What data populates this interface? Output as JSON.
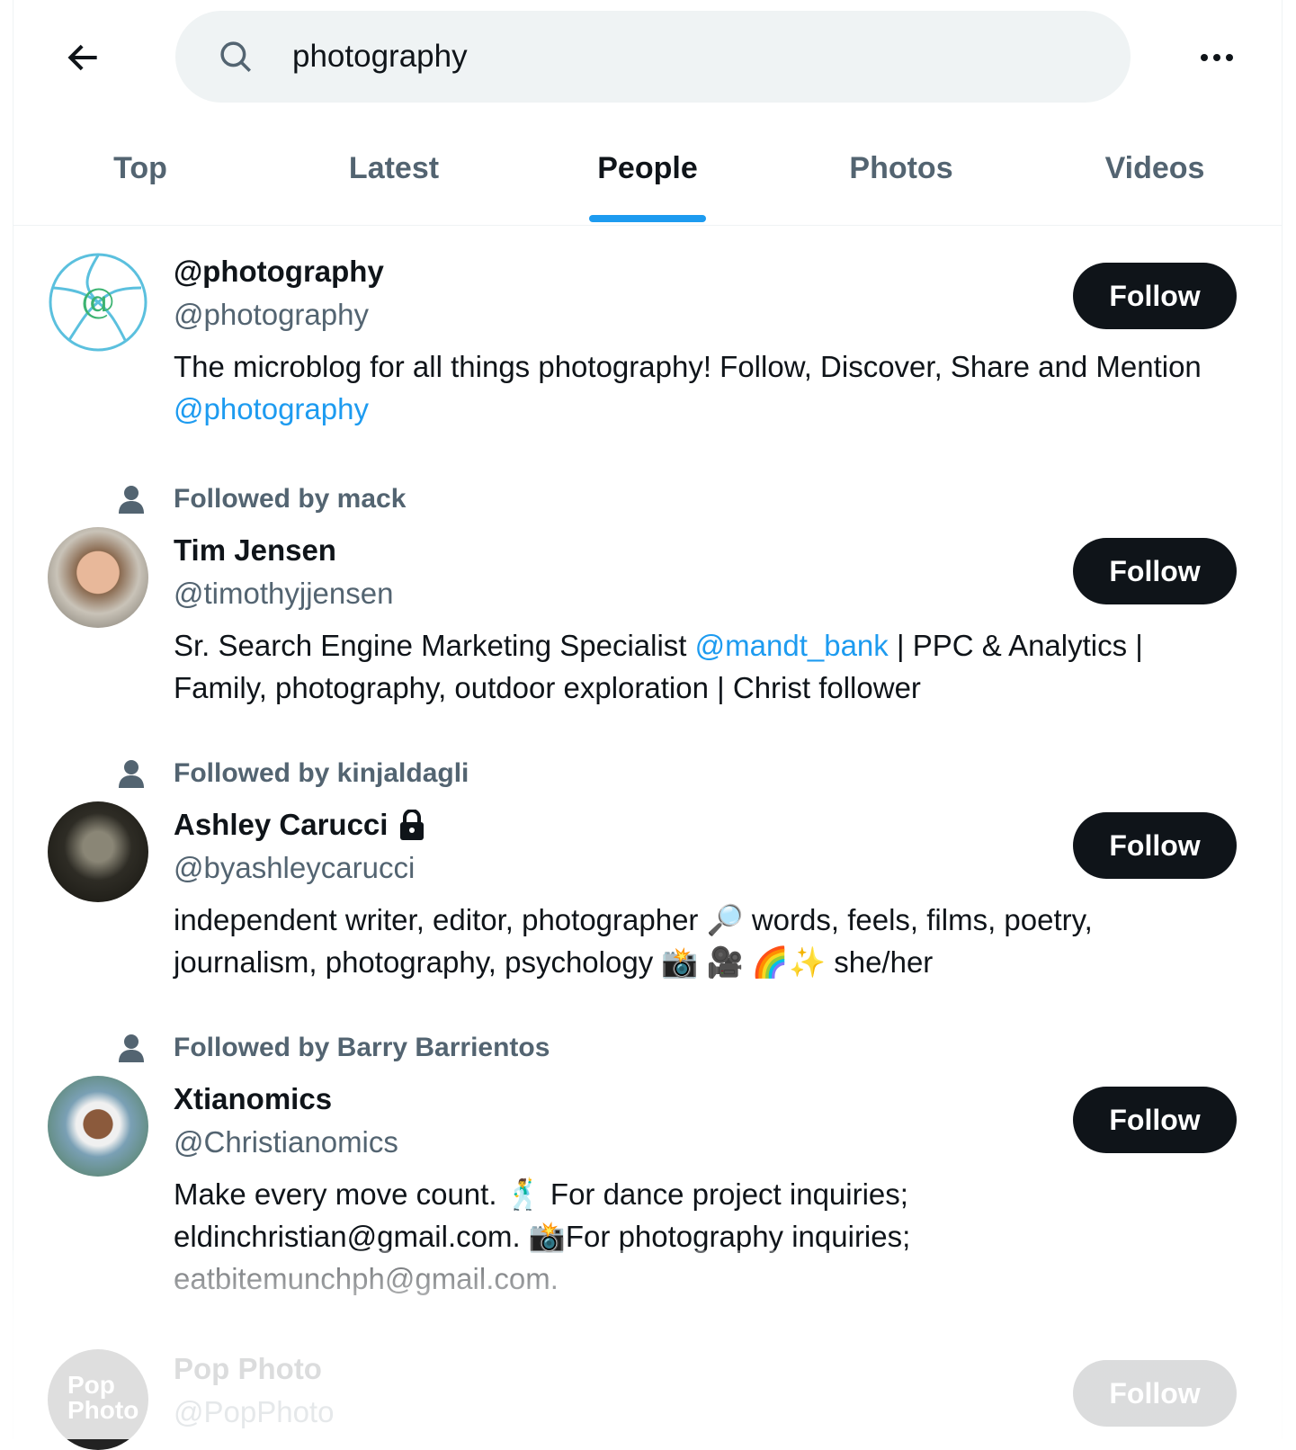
{
  "search": {
    "query": "photography"
  },
  "tabs": [
    {
      "label": "Top"
    },
    {
      "label": "Latest"
    },
    {
      "label": "People",
      "active": true
    },
    {
      "label": "Photos"
    },
    {
      "label": "Videos"
    }
  ],
  "accent": "#1d9bf0",
  "people": [
    {
      "name": "@photography",
      "handle": "@photography",
      "bio": "The microblog for all things photography! Follow, Discover, Share and Mention ",
      "bio_link": "@photography",
      "follow": "Follow"
    },
    {
      "social": "Followed by mack",
      "name": "Tim Jensen",
      "handle": "@timothyjjensen",
      "bio_a": "Sr. Search Engine Marketing Specialist ",
      "bio_link": "@mandt_bank",
      "bio_b": " | PPC & Analytics | Family, photography, outdoor exploration | Christ follower",
      "follow": "Follow"
    },
    {
      "social": "Followed by kinjaldagli",
      "name": "Ashley Carucci",
      "locked": true,
      "handle": "@byashleycarucci",
      "bio": "independent writer, editor, photographer 🔎 words, feels, films, poetry, journalism, photography, psychology 📸 🎥 🌈✨ she/her",
      "follow": "Follow"
    },
    {
      "social": "Followed by Barry Barrientos",
      "name": "Xtianomics",
      "handle": "@Christianomics",
      "bio": "Make every move count. 🕺 For dance project inquiries; eldinchristian@gmail.com. 📸For photography inquiries; eatbitemunchph@gmail.com.",
      "follow": "Follow"
    },
    {
      "name": "Pop Photo",
      "handle": "@PopPhoto",
      "avatar_text": "Pop Photo",
      "follow": "Follow"
    }
  ]
}
